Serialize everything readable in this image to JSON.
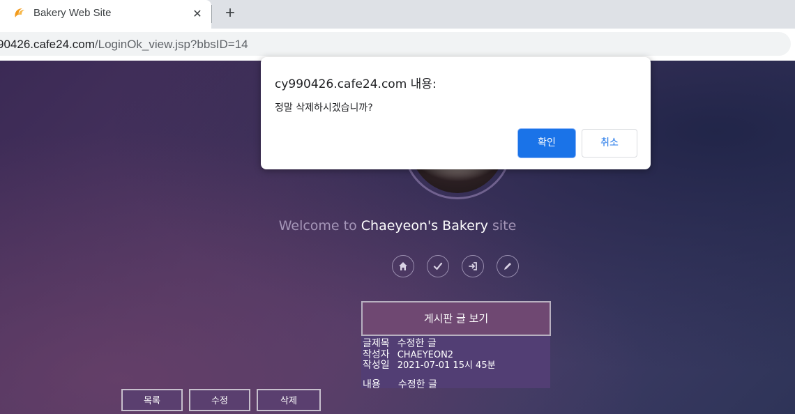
{
  "browser": {
    "tab": {
      "title": "Bakery Web Site",
      "favicon": "croissant-icon",
      "close_icon": "close-icon"
    },
    "new_tab_icon": "plus-icon",
    "url": {
      "host": "90426.cafe24.com",
      "path": "/LoginOk_view.jsp?bbsID=14"
    }
  },
  "page": {
    "welcome": {
      "prefix": "Welcome to ",
      "brand": "Chaeyeon's Bakery",
      "suffix": " site"
    },
    "nav_icons": [
      "home-icon",
      "check-icon",
      "login-icon",
      "pencil-icon"
    ],
    "board": {
      "header": "게시판 글 보기",
      "title_label": "글제목",
      "title_value": "수정한 글",
      "author_label": "작성자",
      "author_value": "CHAEYEON2",
      "date_label": "작성일",
      "date_value": "2021-07-01 15시 45분",
      "content_label": "내용",
      "content_value": "수정한 글"
    },
    "buttons": {
      "list": "목록",
      "edit": "수정",
      "delete": "삭제"
    }
  },
  "dialog": {
    "title": "cy990426.cafe24.com 내용:",
    "message": "정말 삭제하시겠습니까?",
    "ok_label": "확인",
    "cancel_label": "취소"
  },
  "colors": {
    "ok_button": "#1a73e8",
    "board_header": "#6f4872",
    "board_body": "#523e74"
  }
}
